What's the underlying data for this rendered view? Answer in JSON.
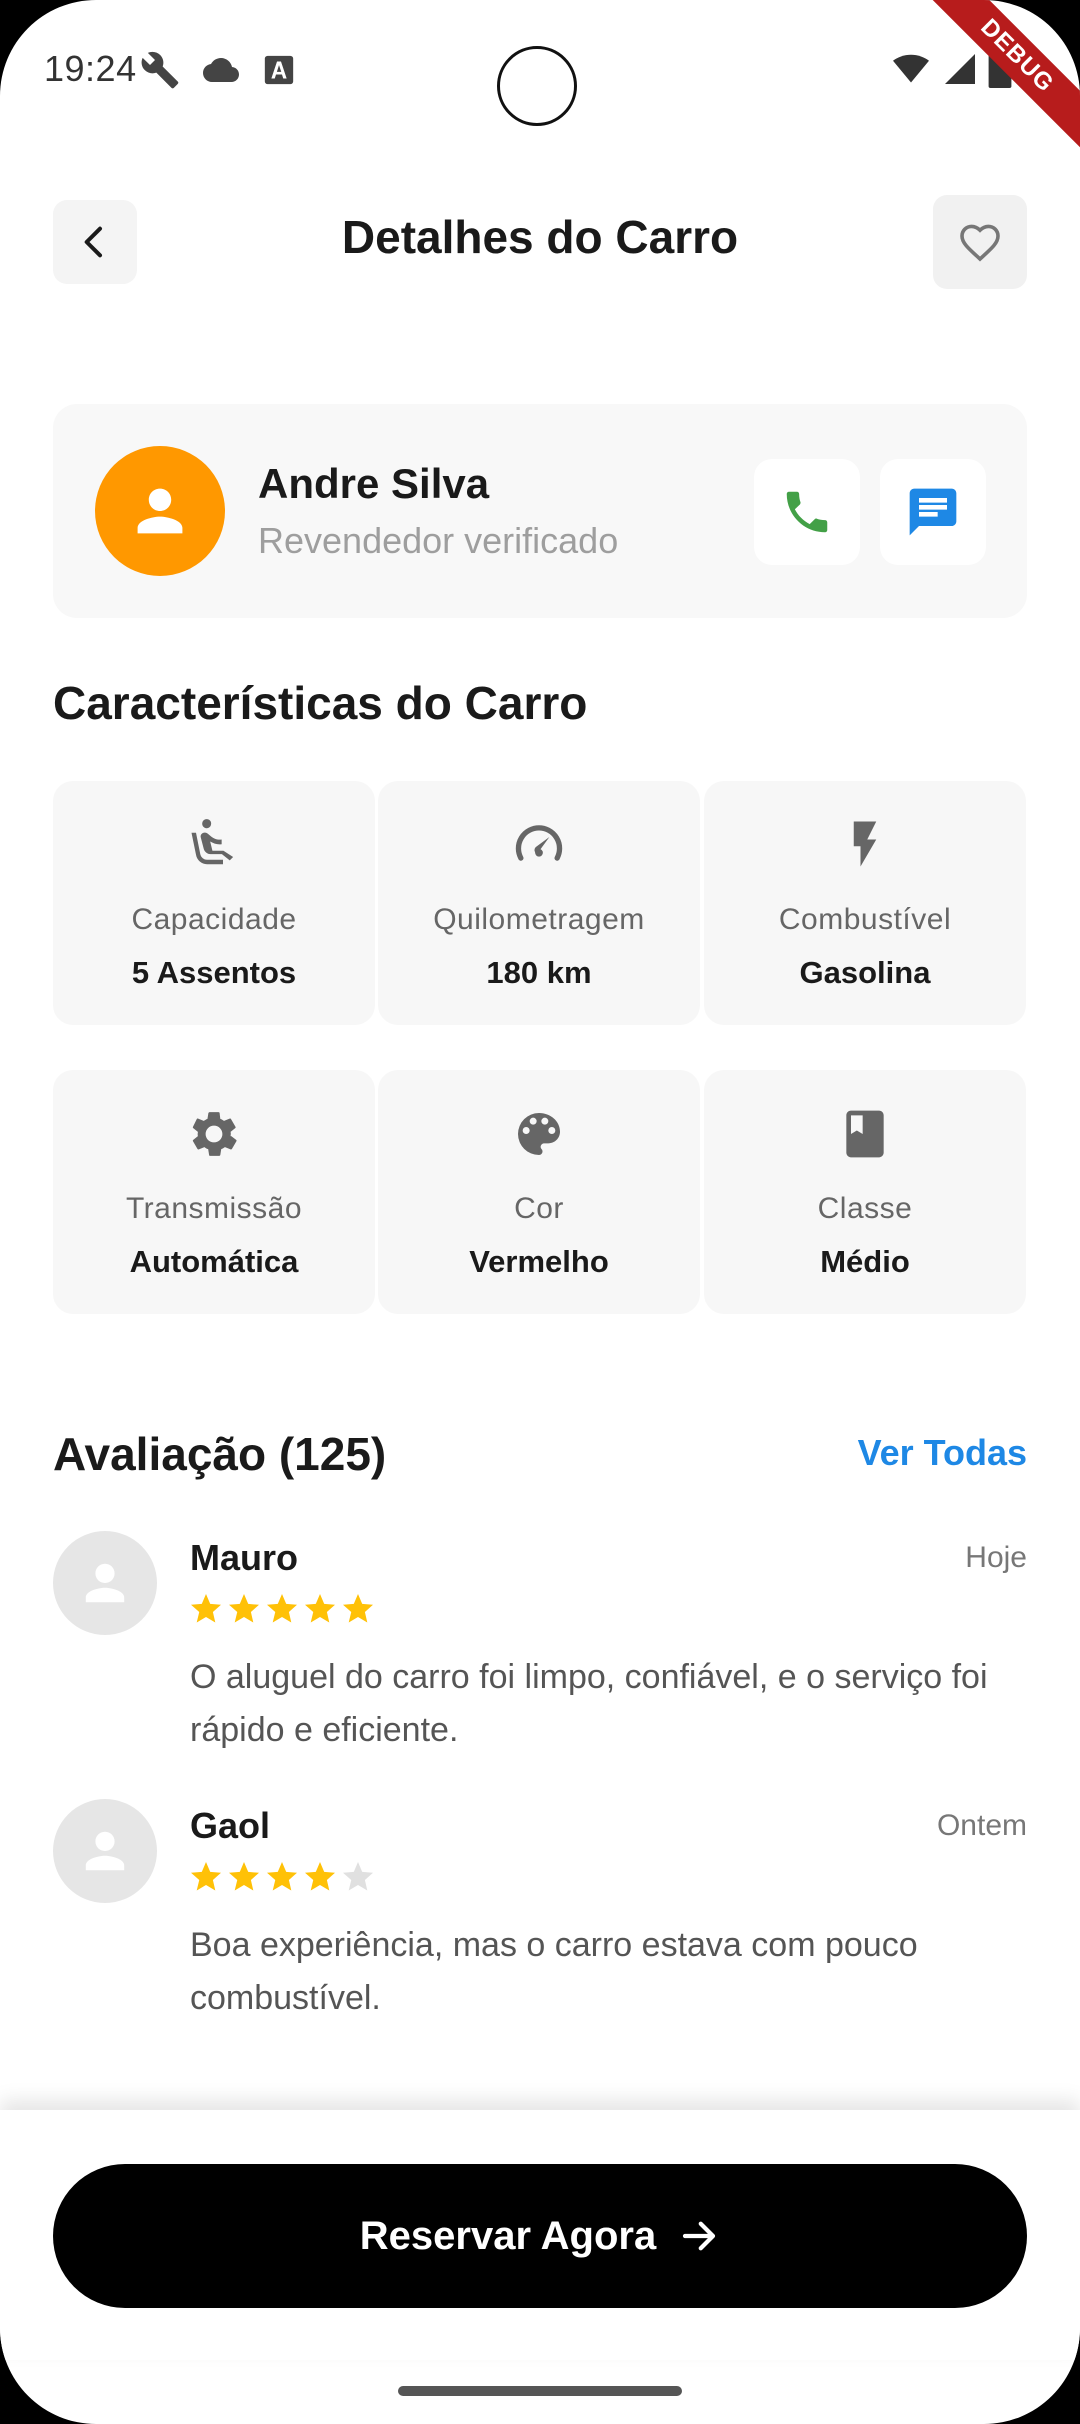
{
  "status_bar": {
    "time": "19:24",
    "debug_label": "DEBUG"
  },
  "header": {
    "title": "Detalhes do Carro"
  },
  "dealer": {
    "name": "Andre Silva",
    "subtitle": "Revendedor verificado",
    "avatar_color": "#FF9800",
    "phone_icon_color": "#43A047",
    "chat_icon_color": "#1E88E5"
  },
  "features": {
    "title": "Características do Carro",
    "items": [
      {
        "icon": "seat-icon",
        "label": "Capacidade",
        "value": "5 Assentos"
      },
      {
        "icon": "speedometer-icon",
        "label": "Quilometragem",
        "value": "180 km"
      },
      {
        "icon": "bolt-icon",
        "label": "Combustível",
        "value": "Gasolina"
      },
      {
        "icon": "gear-icon",
        "label": "Transmissão",
        "value": "Automática"
      },
      {
        "icon": "palette-icon",
        "label": "Cor",
        "value": "Vermelho"
      },
      {
        "icon": "book-icon",
        "label": "Classe",
        "value": "Médio"
      }
    ]
  },
  "reviews": {
    "title": "Avaliação (125)",
    "see_all": "Ver Todas",
    "items": [
      {
        "name": "Mauro",
        "date": "Hoje",
        "rating": 5,
        "text": "O aluguel do carro foi limpo, confiável, e o serviço foi rápido e eficiente."
      },
      {
        "name": "Gaol",
        "date": "Ontem",
        "rating": 4,
        "text": "Boa experiência, mas o carro estava com pouco combustível."
      }
    ],
    "star_color": "#FFC107",
    "star_empty_color": "#E0E0E0"
  },
  "cta": {
    "label": "Reservar Agora"
  }
}
